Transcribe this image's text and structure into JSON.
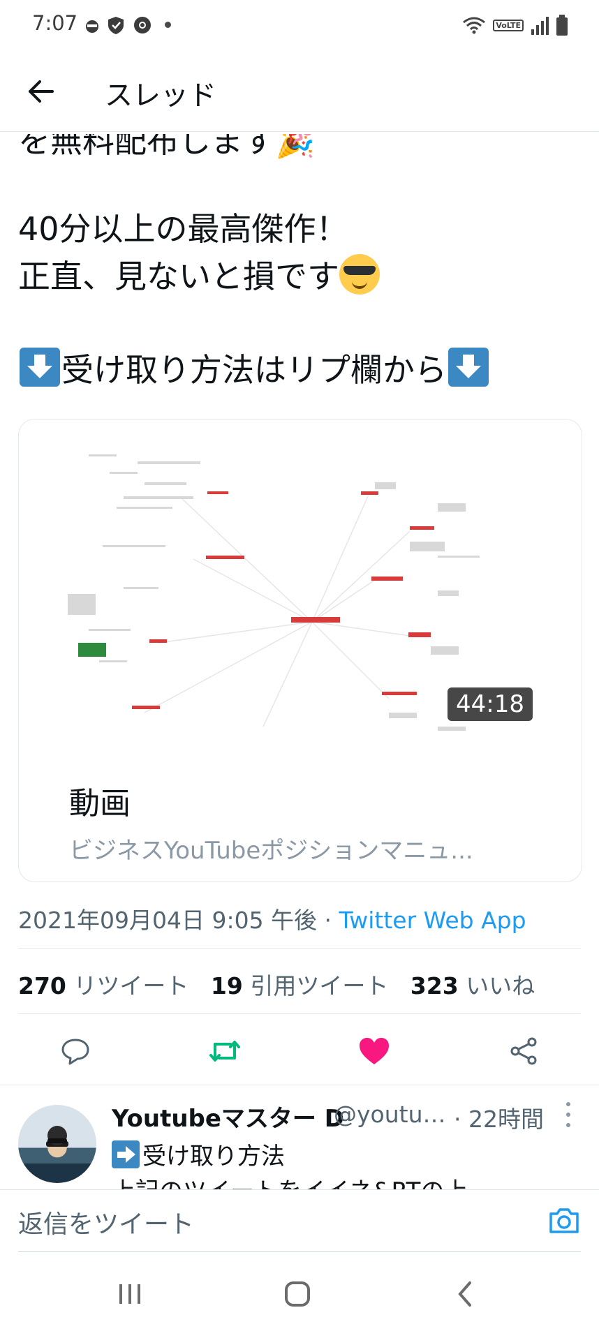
{
  "status_bar": {
    "time": "7:07",
    "icons_left": [
      "ninja-notification-icon",
      "shield-icon",
      "chrome-icon"
    ],
    "icons_right": [
      "wifi-icon",
      "volte-icon",
      "signal-icon",
      "battery-icon"
    ],
    "volte_label": "VoLTE"
  },
  "header": {
    "title": "スレッド"
  },
  "tweet": {
    "cut_line": "を無料配布します🎉",
    "line1": "40分以上の最高傑作！",
    "line2": "正直、見ないと損です",
    "line3": "受け取り方法はリプ欄から",
    "timestamp": "2021年09月04日 9:05 午後",
    "separator": " · ",
    "source": "Twitter Web App",
    "retweets": "270",
    "retweets_label": "リツイート",
    "quotes": "19",
    "quotes_label": "引用ツイート",
    "likes": "323",
    "likes_label": "いいね"
  },
  "card": {
    "duration": "44:18",
    "title": "動画",
    "subtitle": "ビジネスYouTubeポジションマニュ..."
  },
  "reply": {
    "name": "Youtubeマスター D",
    "handle": "@youtu…",
    "time": "· 22時間",
    "line1": "受け取り方法",
    "line2": "上記のツイートをイイネ&RTの上"
  },
  "compose": {
    "placeholder": "返信をツイート"
  },
  "colors": {
    "link": "#1d9bf0",
    "retweet_active": "#00ba7c",
    "like_active": "#f91880",
    "secondary_text": "#536471"
  }
}
